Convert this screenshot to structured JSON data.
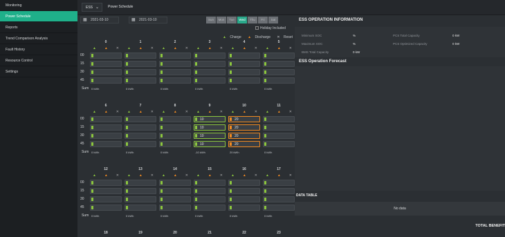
{
  "sidebar": {
    "items": [
      {
        "label": "Monitoring",
        "active": false
      },
      {
        "label": "Power Schedule",
        "active": true
      },
      {
        "label": "Reports",
        "active": false
      },
      {
        "label": "Trend Comparison Analysis",
        "active": false
      },
      {
        "label": "Fault History",
        "active": false
      },
      {
        "label": "Resource Control",
        "active": false
      },
      {
        "label": "Settings",
        "active": false
      }
    ]
  },
  "topbar": {
    "device": "ESS",
    "breadcrumb": "Power Schedule"
  },
  "dates": {
    "start": "2021-03-10",
    "end": "2021-03-10"
  },
  "days": [
    "Sun",
    "Mon",
    "Tue",
    "Wed",
    "Thu",
    "Fri",
    "Sat"
  ],
  "selected_day": "Wed",
  "holiday_label": "Holiday Included",
  "legend": {
    "charge": "Charge",
    "discharge": "Discharge",
    "reset": "Reset"
  },
  "row_labels": [
    "00",
    "15",
    "30",
    "45"
  ],
  "sum_label": "Sum",
  "blocks": [
    {
      "hours": [
        "0",
        "1",
        "2",
        "3",
        "4",
        "5"
      ],
      "sums": [
        "0 kWh",
        "0 kWh",
        "0 kWh",
        "0 kWh",
        "0 kWh",
        "0 kWh"
      ]
    },
    {
      "hours": [
        "6",
        "7",
        "8",
        "9",
        "10",
        "11"
      ],
      "sums": [
        "0 kWh",
        "0 kWh",
        "0 kWh",
        "-10 kWh",
        "20 kWh",
        "0 kWh"
      ]
    },
    {
      "hours": [
        "12",
        "13",
        "14",
        "15",
        "16",
        "17"
      ],
      "sums": [
        "0 kWh",
        "0 kWh",
        "0 kWh",
        "0 kWh",
        "0 kWh",
        "0 kWh"
      ]
    },
    {
      "hours": [
        "18",
        "19",
        "20",
        "21",
        "22",
        "23"
      ],
      "sums": []
    }
  ],
  "block1_values": {
    "col3": [
      "10",
      "10",
      "10",
      "10"
    ],
    "col4": [
      "20",
      "20",
      "20",
      "20"
    ]
  },
  "ess_info": {
    "title": "ESS OPERATION INFORMATION",
    "min_soc_label": "Minimum SOC",
    "min_soc_value": "%",
    "max_soc_label": "Maximum SOC",
    "max_soc_value": "%",
    "bms_label": "BMS Total Capacity",
    "bms_value": "0 kW",
    "pcs_total_label": "PCS Total Capacity",
    "pcs_total_value": "0 kW",
    "pcs_opt_label": "PCS Optimized Capacity",
    "pcs_opt_value": "0 kW"
  },
  "forecast_title": "ESS Operation Forecast",
  "data_table": {
    "title": "DATA TABLE",
    "empty": "No data"
  },
  "total_benefit": "TOTAL BENEFIT"
}
